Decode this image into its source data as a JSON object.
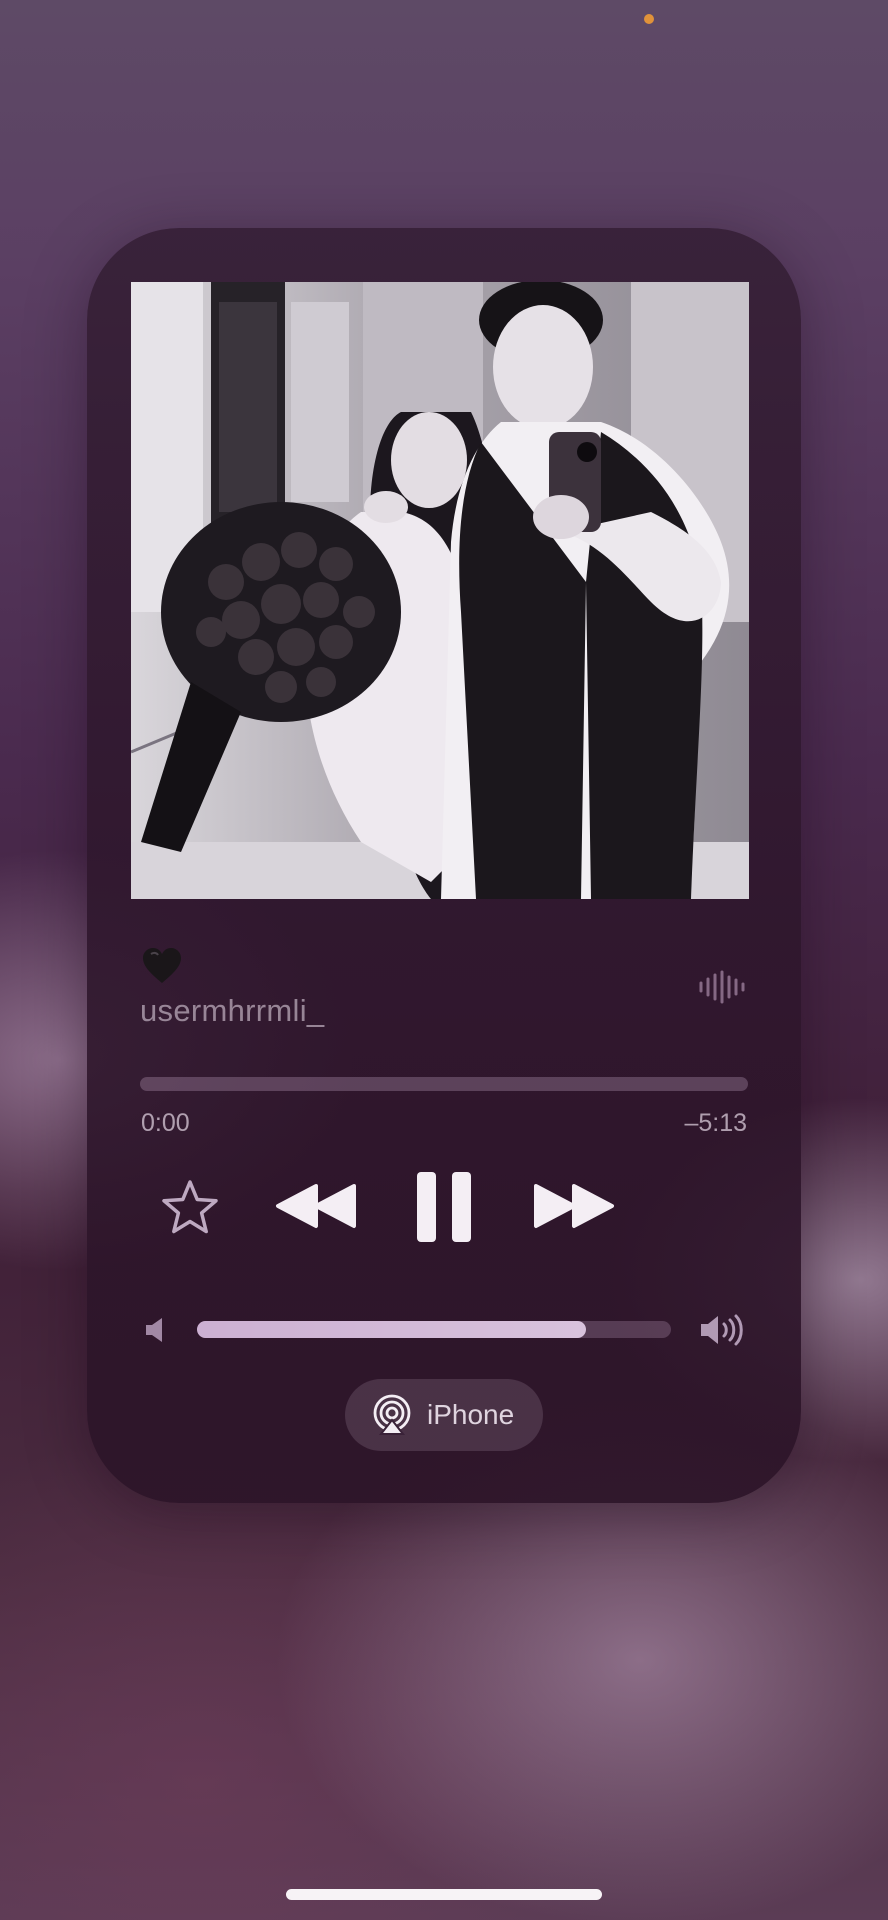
{
  "now_playing": {
    "title_emoji": "🖤",
    "artist": "usermhrrmli_",
    "time_elapsed": "0:00",
    "time_remaining": "–5:13",
    "progress_fraction": 0.0,
    "is_playing": true
  },
  "volume": {
    "level_fraction": 0.82
  },
  "output_device": {
    "label": "iPhone"
  },
  "colors": {
    "privacy_indicator": "#e0923a",
    "control_fill": "#f4eef4",
    "volume_fill": "#ccb0d2"
  },
  "icons": {
    "favorite": "star-outline-icon",
    "previous": "rewind-icon",
    "playback": "pause-icon",
    "next": "fast-forward-icon",
    "volume_low": "speaker-low-icon",
    "volume_high": "speaker-high-icon",
    "audio_output": "airplay-icon",
    "visualizer": "waveform-icon"
  }
}
